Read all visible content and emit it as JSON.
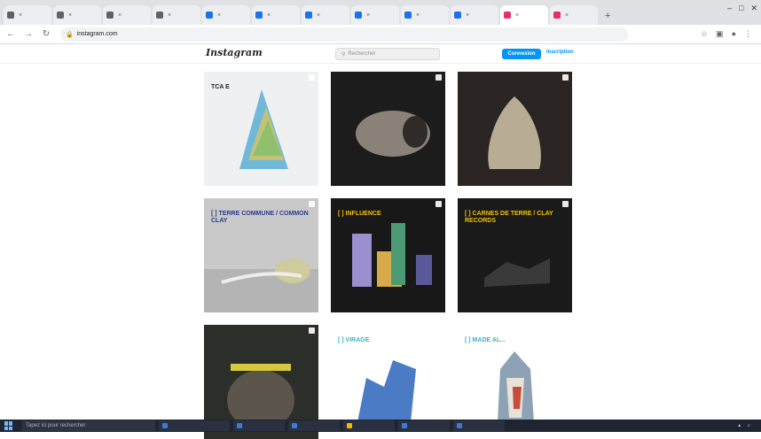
{
  "browser": {
    "tabs": [
      {
        "label": "",
        "color": "#5f6368"
      },
      {
        "label": "",
        "color": "#5f6368"
      },
      {
        "label": "",
        "color": "#5f6368"
      },
      {
        "label": "",
        "color": "#5f6368"
      },
      {
        "label": "",
        "color": "#1a73e8"
      },
      {
        "label": "",
        "color": "#1a73e8"
      },
      {
        "label": "",
        "color": "#1a73e8"
      },
      {
        "label": "",
        "color": "#1a73e8"
      },
      {
        "label": "",
        "color": "#1a73e8"
      },
      {
        "label": "",
        "color": "#1a73e8"
      },
      {
        "label": "",
        "color": "#e1306c"
      },
      {
        "label": "",
        "color": "#e1306c"
      }
    ],
    "url_host": "instagram.com",
    "url_path": ""
  },
  "instagram": {
    "logo": "Instagram",
    "search_placeholder": "Rechercher",
    "login": "Connexion",
    "signup": "Inscription",
    "accent": "#0095f6"
  },
  "posts": [
    {
      "title": "TCA E",
      "bg": "#eef0f2",
      "title_color": "#222"
    },
    {
      "title": "",
      "bg": "#1c1c1c",
      "title_color": "#eee"
    },
    {
      "title": "",
      "bg": "#2a2522",
      "title_color": "#eee"
    },
    {
      "title": "[ ] TERRE COMMUNE / COMMON CLAY",
      "bg": "#c9c9c9",
      "title_color": "#2b3a8f"
    },
    {
      "title": "[ ] INFLUENCE",
      "bg": "#181818",
      "title_color": "#f2c200"
    },
    {
      "title": "[ ] CARNES DE TERRE / CLAY RECORDS",
      "bg": "#1a1a1a",
      "title_color": "#f2c200"
    },
    {
      "title": "",
      "bg": "#2c2e29",
      "title_color": "#7ad36a"
    },
    {
      "title": "[ ] VIRAGE",
      "bg": "#ffffff",
      "title_color": "#3bb0c9"
    },
    {
      "title": "[ ] MADE AL...",
      "bg": "#ffffff",
      "title_color": "#3bb0c9"
    }
  ],
  "taskbar": {
    "search_placeholder": "Tapez ici pour rechercher",
    "apps": [
      {
        "label": "",
        "color": "#3a7bd5"
      },
      {
        "label": "",
        "color": "#3a7bd5"
      },
      {
        "label": "",
        "color": "#3a7bd5"
      },
      {
        "label": "",
        "color": "#f2b705"
      },
      {
        "label": "",
        "color": "#3a7bd5"
      },
      {
        "label": "",
        "color": "#3a7bd5"
      }
    ],
    "clock": ""
  }
}
